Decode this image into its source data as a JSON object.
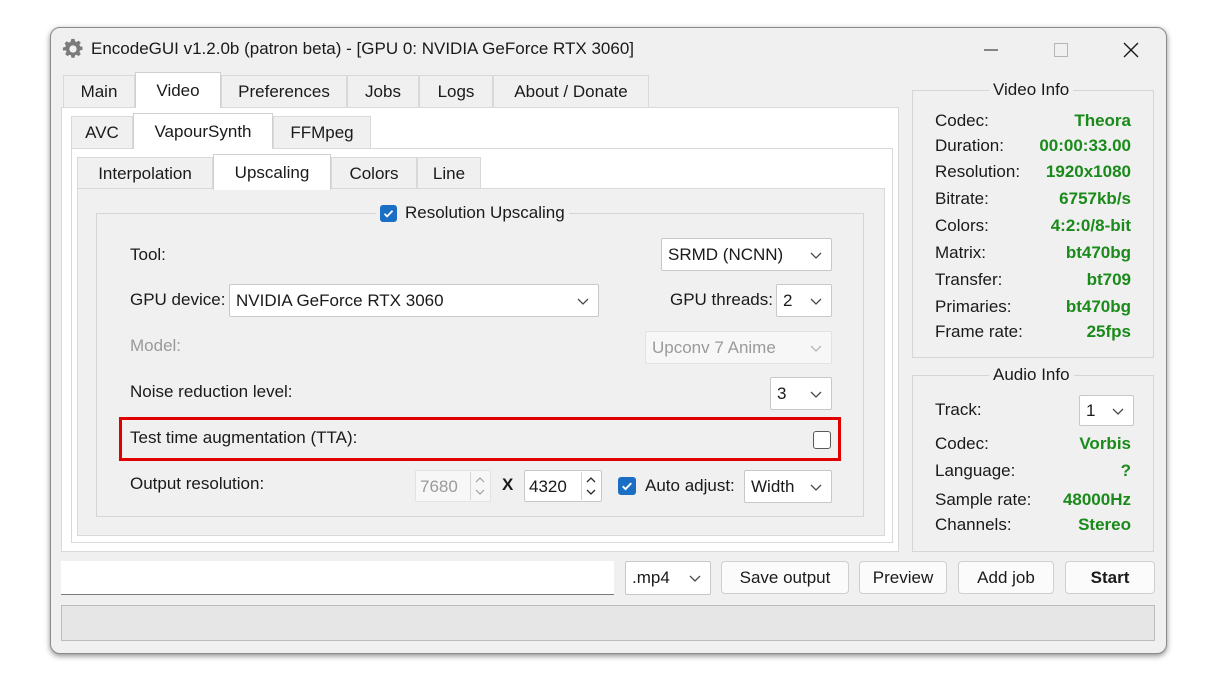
{
  "window": {
    "title": "EncodeGUI v1.2.0b (patron beta) - [GPU 0: NVIDIA GeForce RTX 3060]",
    "icon": "gear-icon",
    "controls": [
      "minimize-icon",
      "maximize-icon",
      "close-icon"
    ]
  },
  "main_tabs": [
    "Main",
    "Video",
    "Preferences",
    "Jobs",
    "Logs",
    "About / Donate"
  ],
  "main_tab_active": "Video",
  "video_tabs": [
    "AVC",
    "VapourSynth",
    "FFMpeg"
  ],
  "video_tab_active": "VapourSynth",
  "vs_tabs": [
    "Interpolation",
    "Upscaling",
    "Colors",
    "Line"
  ],
  "vs_tab_active": "Upscaling",
  "upscaling": {
    "group_label": "Resolution Upscaling",
    "group_checked": true,
    "tool_label": "Tool:",
    "tool_value": "SRMD (NCNN)",
    "gpu_device_label": "GPU device:",
    "gpu_device_value": "NVIDIA GeForce RTX 3060",
    "gpu_threads_label": "GPU threads:",
    "gpu_threads_value": "2",
    "model_label": "Model:",
    "model_value": "Upconv 7 Anime",
    "noise_label": "Noise reduction level:",
    "noise_value": "3",
    "tta_label": "Test time augmentation (TTA):",
    "tta_checked": false,
    "output_res_label": "Output resolution:",
    "output_width": "7680",
    "x_sep": "X",
    "output_height": "4320",
    "auto_adjust_label": "Auto adjust:",
    "auto_adjust_checked": true,
    "auto_adjust_value": "Width"
  },
  "video_info": {
    "title": "Video Info",
    "rows": [
      {
        "key": "Codec:",
        "value": "Theora"
      },
      {
        "key": "Duration:",
        "value": "00:00:33.00"
      },
      {
        "key": "Resolution:",
        "value": "1920x1080"
      },
      {
        "key": "Bitrate:",
        "value": "6757kb/s"
      },
      {
        "key": "Colors:",
        "value": "4:2:0/8-bit"
      },
      {
        "key": "Matrix:",
        "value": "bt470bg"
      },
      {
        "key": "Transfer:",
        "value": "bt709"
      },
      {
        "key": "Primaries:",
        "value": "bt470bg"
      },
      {
        "key": "Frame rate:",
        "value": "25fps"
      }
    ]
  },
  "audio_info": {
    "title": "Audio Info",
    "track_label": "Track:",
    "track_value": "1",
    "rows": [
      {
        "key": "Codec:",
        "value": "Vorbis"
      },
      {
        "key": "Language:",
        "value": "?"
      },
      {
        "key": "Sample rate:",
        "value": "48000Hz"
      },
      {
        "key": "Channels:",
        "value": "Stereo"
      }
    ]
  },
  "bottom": {
    "output_path": "",
    "container_value": ".mp4",
    "save_output": "Save output",
    "preview": "Preview",
    "add_job": "Add job",
    "start": "Start"
  },
  "colors": {
    "accent": "#1a6fc4",
    "value_green": "#1a8a1a",
    "highlight_red": "#e00000"
  }
}
